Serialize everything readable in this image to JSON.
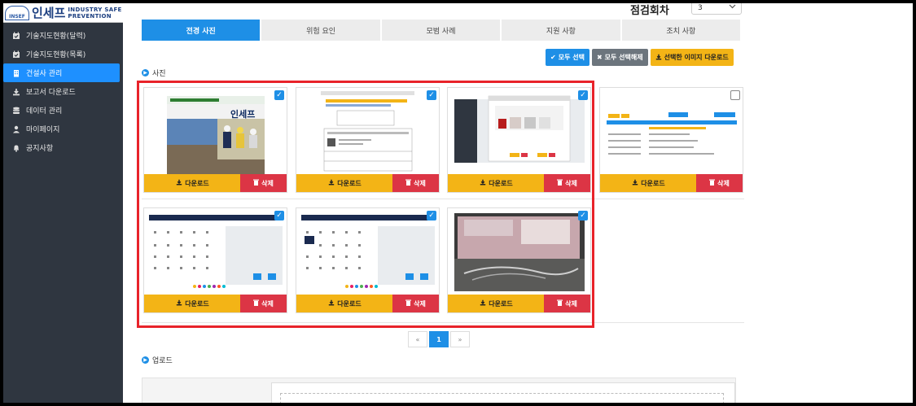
{
  "logo": {
    "mark": "INSEF",
    "korean": "인세프",
    "english_line1": "INDUSTRY SAFE",
    "english_line2": "PREVENTION"
  },
  "sidebar": {
    "items": [
      {
        "label": "기술지도현황(달력)",
        "icon": "calendar-check-icon",
        "active": false
      },
      {
        "label": "기술지도현황(목록)",
        "icon": "calendar-check-icon",
        "active": false
      },
      {
        "label": "건설사 관리",
        "icon": "building-icon",
        "active": true
      },
      {
        "label": "보고서 다운로드",
        "icon": "download-icon",
        "active": false
      },
      {
        "label": "데이터 관리",
        "icon": "database-icon",
        "active": false
      },
      {
        "label": "마이페이지",
        "icon": "user-icon",
        "active": false
      },
      {
        "label": "공지사항",
        "icon": "bell-icon",
        "active": false
      }
    ]
  },
  "header": {
    "round_label": "점검회차",
    "round_value": "3"
  },
  "tabs": [
    {
      "label": "전경 사진",
      "active": true
    },
    {
      "label": "위험 요인",
      "active": false
    },
    {
      "label": "모범 사례",
      "active": false
    },
    {
      "label": "지원 사항",
      "active": false
    },
    {
      "label": "조치 사항",
      "active": false
    }
  ],
  "actions": {
    "select_all": "모두 선택",
    "deselect_all": "모두 선택해제",
    "download_selected": "선택한 이미지 다운로드"
  },
  "photos_section": {
    "title": "사진"
  },
  "cards": [
    {
      "thumbnail": "safety-company-banner",
      "checked": true,
      "download_label": "다운로드",
      "delete_label": "삭제",
      "thumb_caption": "인세프"
    },
    {
      "thumbnail": "document-form",
      "checked": true,
      "download_label": "다운로드",
      "delete_label": "삭제",
      "thumb_caption": ""
    },
    {
      "thumbnail": "app-dialog-screenshot",
      "checked": true,
      "download_label": "다운로드",
      "delete_label": "삭제",
      "thumb_caption": ""
    },
    {
      "thumbnail": "table-form",
      "checked": false,
      "download_label": "다운로드",
      "delete_label": "삭제",
      "thumb_caption": ""
    },
    {
      "thumbnail": "calendar-app",
      "checked": true,
      "download_label": "다운로드",
      "delete_label": "삭제",
      "thumb_caption": ""
    },
    {
      "thumbnail": "calendar-app-selected",
      "checked": true,
      "download_label": "다운로드",
      "delete_label": "삭제",
      "thumb_caption": ""
    },
    {
      "thumbnail": "monitor-photo",
      "checked": true,
      "download_label": "다운로드",
      "delete_label": "삭제",
      "thumb_caption": ""
    }
  ],
  "pagination": {
    "prev": "«",
    "current": "1",
    "next": "»"
  },
  "upload_section": {
    "title": "업로드"
  },
  "colors": {
    "primary": "#1e8fe6",
    "warning": "#f3b416",
    "danger": "#dc3545",
    "sidebar": "#2f3640",
    "highlight": "#e8232a"
  }
}
